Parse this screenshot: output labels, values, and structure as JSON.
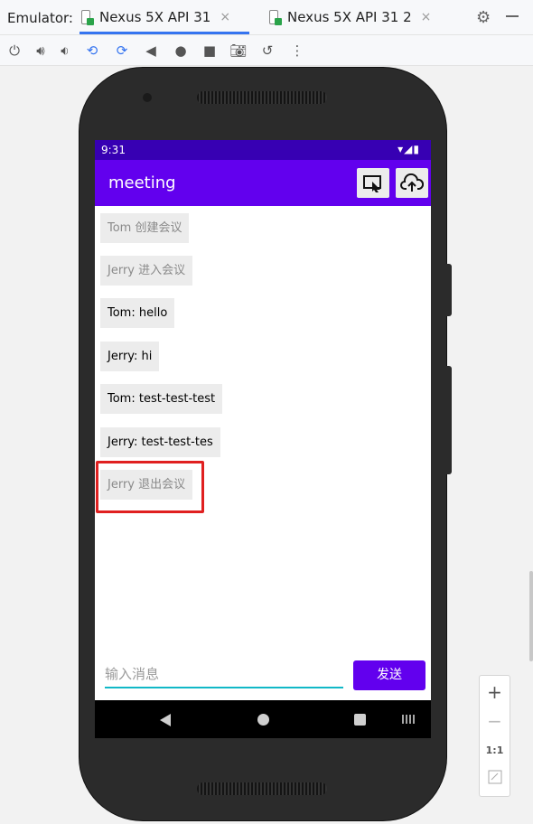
{
  "ide": {
    "emulator_label": "Emulator:",
    "tabs": [
      {
        "label": "Nexus 5X API 31",
        "active": true
      },
      {
        "label": "Nexus 5X API 31 2",
        "active": false
      }
    ],
    "close_glyph": "×",
    "settings_icon": "gear-icon",
    "toolbar_icons": [
      "power-icon",
      "volume-up-icon",
      "volume-down-icon",
      "rotate-left-icon",
      "rotate-right-icon",
      "back-icon",
      "home-icon",
      "overview-icon",
      "camera-icon",
      "snapshot-icon",
      "more-icon"
    ]
  },
  "device": {
    "status": {
      "time": "9:31",
      "icons": "▾◢▮"
    },
    "app_title": "meeting",
    "messages": [
      {
        "text": "Tom 创建会议",
        "type": "system"
      },
      {
        "text": "Jerry 进入会议",
        "type": "system"
      },
      {
        "text": "Tom: hello",
        "type": "chat"
      },
      {
        "text": "Jerry: hi",
        "type": "chat"
      },
      {
        "text": "Tom: test-test-test",
        "type": "chat"
      },
      {
        "text": "Jerry: test-test-tes",
        "type": "chat"
      },
      {
        "text": "Jerry 退出会议",
        "type": "system"
      }
    ],
    "input_placeholder": "输入消息",
    "send_label": "发送"
  },
  "zoom": {
    "plus": "+",
    "minus": "−",
    "one_to_one": "1:1"
  },
  "colors": {
    "accent": "#6200ee",
    "status_bar": "#3700b3",
    "highlight": "#e02020",
    "tab_underline": "#3574f0"
  }
}
